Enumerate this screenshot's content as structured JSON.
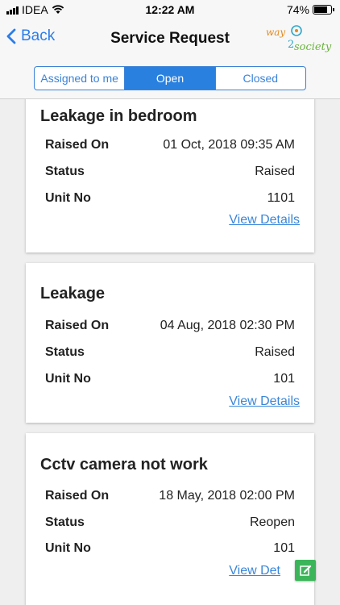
{
  "status_bar": {
    "carrier": "IDEA",
    "time": "12:22 AM",
    "battery": "74%",
    "battery_level": 0.74
  },
  "nav": {
    "back_label": "Back",
    "title": "Service Request",
    "logo_text_top": "way",
    "logo_text_bottom": "society",
    "logo_digit": "2"
  },
  "tabs": [
    {
      "label": "Assigned to me",
      "active": false
    },
    {
      "label": "Open",
      "active": true
    },
    {
      "label": "Closed",
      "active": false
    }
  ],
  "requests": [
    {
      "title": "Leakage in bedroom",
      "raised_on_label": "Raised On",
      "raised_on": "01 Oct, 2018 09:35 AM",
      "status_label": "Status",
      "status": "Raised",
      "unit_label": "Unit No",
      "unit": "1101",
      "link": "View Details"
    },
    {
      "title": "Leakage",
      "raised_on_label": "Raised On",
      "raised_on": "04 Aug, 2018 02:30 PM",
      "status_label": "Status",
      "status": "Raised",
      "unit_label": "Unit No",
      "unit": "101",
      "link": "View Details"
    },
    {
      "title": "Cctv camera not work",
      "raised_on_label": "Raised On",
      "raised_on": "18 May, 2018 02:00 PM",
      "status_label": "Status",
      "status": "Reopen",
      "unit_label": "Unit No",
      "unit": "101",
      "link": "View Det"
    }
  ],
  "colors": {
    "accent": "#2a80de",
    "link": "#3a86d9",
    "fab": "#3cb55a"
  }
}
